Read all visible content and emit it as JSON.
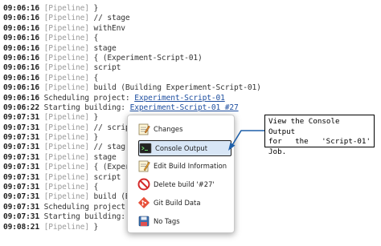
{
  "console": {
    "lines": [
      {
        "time": "09:06:16",
        "tag": "[Pipeline]",
        "text": " }"
      },
      {
        "time": "09:06:16",
        "tag": "[Pipeline]",
        "text": " // stage"
      },
      {
        "time": "09:06:16",
        "tag": "[Pipeline]",
        "text": " withEnv"
      },
      {
        "time": "09:06:16",
        "tag": "[Pipeline]",
        "text": " {"
      },
      {
        "time": "09:06:16",
        "tag": "[Pipeline]",
        "text": " stage"
      },
      {
        "time": "09:06:16",
        "tag": "[Pipeline]",
        "text": " { (Experiment-Script-01)"
      },
      {
        "time": "09:06:16",
        "tag": "[Pipeline]",
        "text": " script"
      },
      {
        "time": "09:06:16",
        "tag": "[Pipeline]",
        "text": " {"
      },
      {
        "time": "09:06:16",
        "tag": "[Pipeline]",
        "text": " build (Building Experiment-Script-01)"
      },
      {
        "time": "09:06:16",
        "tag": "",
        "text": "Scheduling project: ",
        "link": "Experiment-Script-01"
      },
      {
        "time": "09:06:22",
        "tag": "",
        "text": "Starting building: ",
        "link": "Experiment-Script-01 #27"
      },
      {
        "time": "09:07:31",
        "tag": "[Pipeline]",
        "text": " }"
      },
      {
        "time": "09:07:31",
        "tag": "[Pipeline]",
        "text": " // scrip"
      },
      {
        "time": "09:07:31",
        "tag": "[Pipeline]",
        "text": " }"
      },
      {
        "time": "09:07:31",
        "tag": "[Pipeline]",
        "text": " // stag"
      },
      {
        "time": "09:07:31",
        "tag": "[Pipeline]",
        "text": " stage"
      },
      {
        "time": "09:07:31",
        "tag": "[Pipeline]",
        "text": " { (Exper"
      },
      {
        "time": "09:07:31",
        "tag": "[Pipeline]",
        "text": " script"
      },
      {
        "time": "09:07:31",
        "tag": "[Pipeline]",
        "text": " {"
      },
      {
        "time": "09:07:31",
        "tag": "[Pipeline]",
        "text": " build (B"
      },
      {
        "time": "09:07:31",
        "tag": "",
        "text": "Scheduling project:"
      },
      {
        "time": "09:07:31",
        "tag": "",
        "text": "Starting building:"
      },
      {
        "time": "09:08:21",
        "tag": "[Pipeline]",
        "text": " }"
      }
    ]
  },
  "menu": {
    "items": [
      {
        "label": "Changes",
        "icon": "changes-notepad-icon"
      },
      {
        "label": "Console Output",
        "icon": "terminal-icon"
      },
      {
        "label": "Edit Build Information",
        "icon": "edit-notepad-icon"
      },
      {
        "label": "Delete build '#27'",
        "icon": "no-entry-icon"
      },
      {
        "label": "Git Build Data",
        "icon": "git-icon"
      },
      {
        "label": "No Tags",
        "icon": "save-disk-icon"
      }
    ],
    "highlighted": "Console Output"
  },
  "callout": {
    "line1": "View the Console Output",
    "line2_words": [
      "for",
      "the",
      "'Script-01'"
    ],
    "line3": "Job."
  },
  "colors": {
    "timestamp": "#222222",
    "pipeline_tag": "#9a9a9a",
    "link": "#1f4fa0",
    "highlight_bg": "#d8e6f6",
    "arrow": "#1e5fa8"
  }
}
